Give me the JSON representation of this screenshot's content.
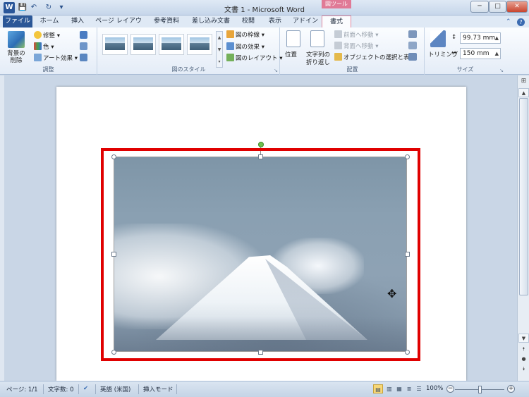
{
  "titlebar": {
    "title": "文書 1  -  Microsoft Word",
    "tool_group": "図ツール",
    "qat": {
      "save": "💾",
      "undo": "↶",
      "redo": "↻",
      "customize": "▾"
    },
    "controls": {
      "minimize": "─",
      "maximize": "□",
      "close": "✕"
    }
  },
  "tabs": [
    {
      "label": "ファイル"
    },
    {
      "label": "ホーム"
    },
    {
      "label": "挿入"
    },
    {
      "label": "ページ レイアウト"
    },
    {
      "label": "参考資料"
    },
    {
      "label": "差し込み文書"
    },
    {
      "label": "校閲"
    },
    {
      "label": "表示"
    },
    {
      "label": "アドイン"
    },
    {
      "label": "書式"
    }
  ],
  "tab_right": {
    "collapse": "⌃",
    "help": "?"
  },
  "ribbon": {
    "adjust": {
      "label": "調整",
      "remove_bg": "背景の削除",
      "correct": "修整",
      "color": "色",
      "art_effects": "アート効果"
    },
    "styles": {
      "label": "図のスタイル",
      "border": "図の枠線",
      "effects": "図の効果",
      "layout": "図のレイアウト"
    },
    "arrange": {
      "label": "配置",
      "position": "位置",
      "wrap_line1": "文字列の",
      "wrap_line2": "折り返し",
      "bring_forward": "前面へ移動",
      "send_backward": "背面へ移動",
      "selection_pane": "オブジェクトの選択と表示"
    },
    "size": {
      "label": "サイズ",
      "crop": "トリミング",
      "height": "99.73 mm",
      "width": "150 mm"
    }
  },
  "statusbar": {
    "page": "ページ: 1/1",
    "words": "文字数: 0",
    "language": "英語 (米国)",
    "mode": "挿入モード",
    "zoom": "100%"
  },
  "colors": {
    "file_tab": "#2b5797",
    "highlight": "#e00000",
    "rotate_handle": "#6fc04e",
    "contextual_tab": "#e07a96"
  }
}
